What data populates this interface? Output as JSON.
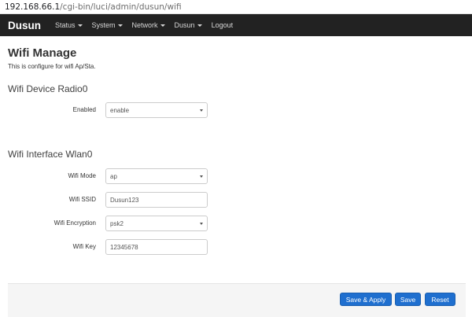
{
  "browser": {
    "url_host": "192.168.66.1",
    "url_path": "/cgi-bin/luci/admin/dusun/wifi"
  },
  "navbar": {
    "brand": "Dusun",
    "items": [
      {
        "label": "Status",
        "has_dropdown": true
      },
      {
        "label": "System",
        "has_dropdown": true
      },
      {
        "label": "Network",
        "has_dropdown": true
      },
      {
        "label": "Dusun",
        "has_dropdown": true
      },
      {
        "label": "Logout",
        "has_dropdown": false
      }
    ]
  },
  "page": {
    "title": "Wifi Manage",
    "description": "This is configure for wifi Ap/Sta."
  },
  "radio_section": {
    "title": "Wifi Device Radio0",
    "enabled_label": "Enabled",
    "enabled_value": "enable"
  },
  "interface_section": {
    "title": "Wifi Interface Wlan0",
    "mode_label": "Wifi Mode",
    "mode_value": "ap",
    "ssid_label": "Wifi SSID",
    "ssid_value": "Dusun123",
    "encryption_label": "Wifi Encryption",
    "encryption_value": "psk2",
    "key_label": "Wifi Key",
    "key_value": "12345678"
  },
  "actions": {
    "save_apply": "Save & Apply",
    "save": "Save",
    "reset": "Reset"
  },
  "colors": {
    "navbar_bg": "#222222",
    "button_primary": "#1f6fcf",
    "footer_bg": "#f5f5f5"
  }
}
